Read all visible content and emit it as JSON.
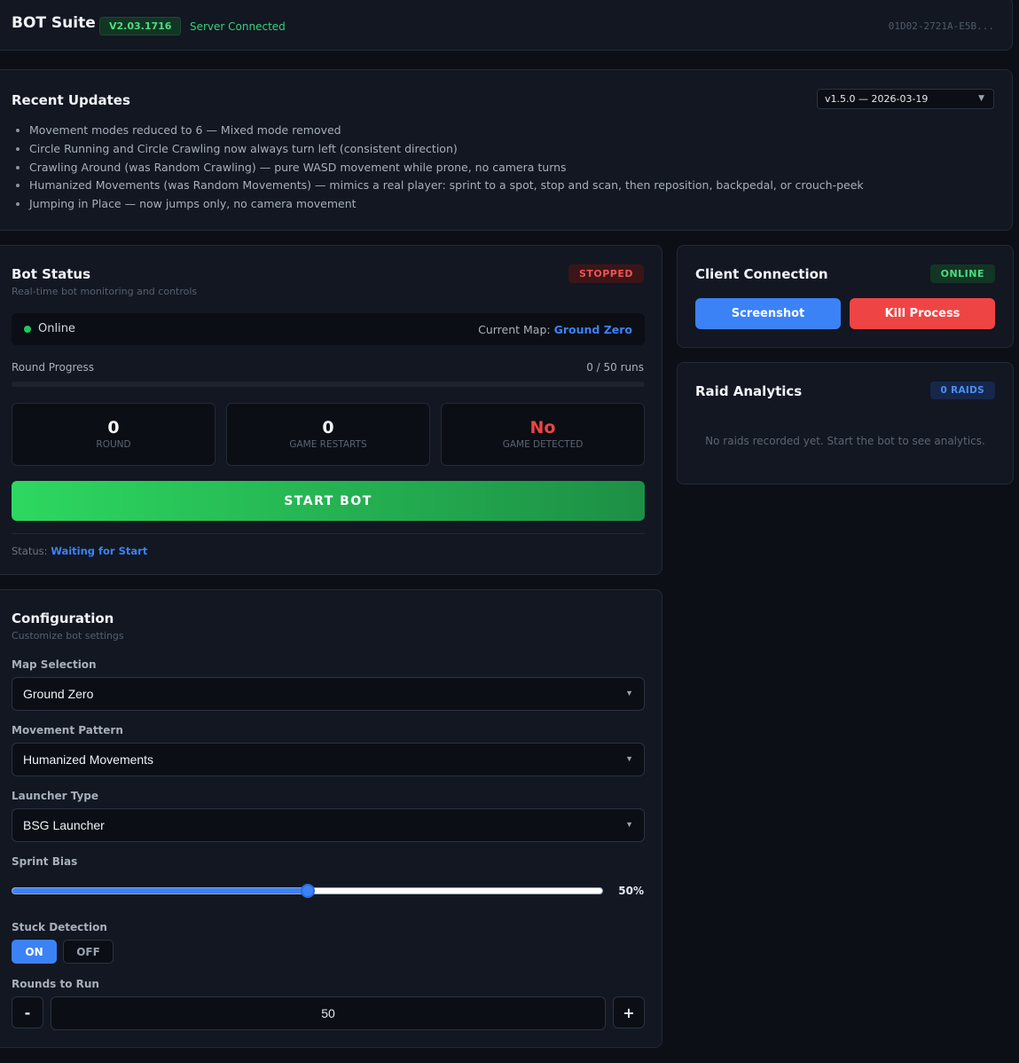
{
  "header": {
    "brand": "BOT Suite",
    "version": "V2.03.1716",
    "server_status": "Server Connected",
    "hwid": "01D02-2721A-E5B..."
  },
  "updates": {
    "title": "Recent Updates",
    "version_select": "v1.5.0 — 2026-03-19",
    "items": [
      "Movement modes reduced to 6 — Mixed mode removed",
      "Circle Running and Circle Crawling now always turn left (consistent direction)",
      "Crawling Around (was Random Crawling) — pure WASD movement while prone, no camera turns",
      "Humanized Movements (was Random Movements) — mimics a real player: sprint to a spot, stop and scan, then reposition, backpedal, or crouch-peek",
      "Jumping in Place — now jumps only, no camera movement"
    ]
  },
  "bot_status": {
    "title": "Bot Status",
    "subtitle": "Real-time bot monitoring and controls",
    "badge": "STOPPED",
    "online_text": "Online",
    "current_map_label": "Current Map:",
    "current_map_value": "Ground Zero",
    "progress_label": "Round Progress",
    "progress_count": "0 / 50 runs",
    "progress_fraction": 0,
    "stats": [
      {
        "value": "0",
        "label": "ROUND"
      },
      {
        "value": "0",
        "label": "GAME RESTARTS"
      },
      {
        "value": "No",
        "label": "GAME DETECTED"
      }
    ],
    "start_label": "START BOT",
    "status_label": "Status:",
    "status_value": "Waiting for Start"
  },
  "client": {
    "title": "Client Connection",
    "badge": "ONLINE",
    "screenshot_label": "Screenshot",
    "kill_label": "Kill Process"
  },
  "raid": {
    "title": "Raid Analytics",
    "badge": "0 RAIDS",
    "empty_text": "No raids recorded yet. Start the bot to see analytics."
  },
  "config": {
    "title": "Configuration",
    "subtitle": "Customize bot settings",
    "map_label": "Map Selection",
    "map_value": "Ground Zero",
    "movement_label": "Movement Pattern",
    "movement_value": "Humanized Movements",
    "launcher_label": "Launcher Type",
    "launcher_value": "BSG Launcher",
    "sprint_label": "Sprint Bias",
    "sprint_percent": 50,
    "sprint_value_text": "50%",
    "stuck_label": "Stuck Detection",
    "stuck_on": "ON",
    "stuck_off": "OFF",
    "rounds_label": "Rounds to Run",
    "rounds_minus": "-",
    "rounds_value": "50",
    "rounds_plus": "+"
  },
  "colors": {
    "accent_blue": "#3b82f6",
    "success_green": "#22c55e",
    "danger_red": "#ef4444",
    "background": "#0c0f15",
    "card": "#121722"
  }
}
